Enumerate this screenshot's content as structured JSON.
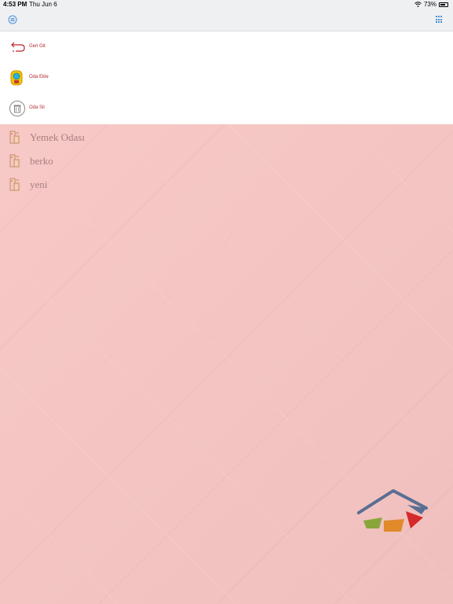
{
  "status_bar": {
    "time": "4:53 PM",
    "date": "Thu Jun 6",
    "battery": "73%",
    "wifi_icon": "wifi-icon",
    "battery_icon": "battery-icon"
  },
  "nav": {
    "menu_icon": "menu-icon",
    "grid_icon": "grid-icon",
    "accent_color": "#4a8fd6"
  },
  "dropdown_menu": {
    "items": [
      {
        "label": "Geri Git",
        "icon": "back-arrow-icon"
      },
      {
        "label": "Oda Ekle",
        "icon": "add-room-icon"
      },
      {
        "label": "Oda Sil",
        "icon": "trash-icon"
      }
    ],
    "label_color": "#b4262a"
  },
  "rooms": {
    "items": [
      {
        "label": "Yemek Odası",
        "icon": "room-door-icon"
      },
      {
        "label": "berko",
        "icon": "room-door-icon"
      },
      {
        "label": "yeni",
        "icon": "room-door-icon"
      }
    ]
  },
  "brand": {
    "logo_icon": "house-logo-icon",
    "background_color": "#f7c6c4"
  }
}
